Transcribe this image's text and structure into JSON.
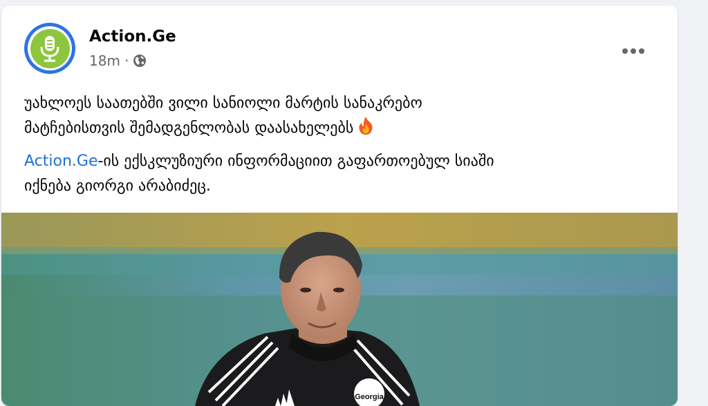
{
  "post": {
    "author": "Action.Ge",
    "time": "18m",
    "separator": "·",
    "audience_icon": "globe-icon",
    "more_icon": "ellipsis-icon",
    "avatar_icon": "microphone-logo",
    "text_line1": "უახლოეს საათებში ვილი სანიოლი მარტის სანაკრებო",
    "text_line2": "მატჩებისთვის შემადგენლობას დაასახელებს",
    "emoji": "fire-emoji",
    "link_text": "Action.Ge",
    "text_after_link": "-ის ექსკლუზიური ინფორმაციით გაფართოებულ სიაში",
    "text_line4": "იქნება გიორგი არაბიძეც.",
    "colors": {
      "link": "#1f6fd1",
      "avatar_ring": "#2d73e6",
      "avatar_green": "#8cc63f",
      "meta": "#65676b",
      "background": "#f0f2f5"
    }
  },
  "photo": {
    "jacket_badge": "Georgia"
  }
}
